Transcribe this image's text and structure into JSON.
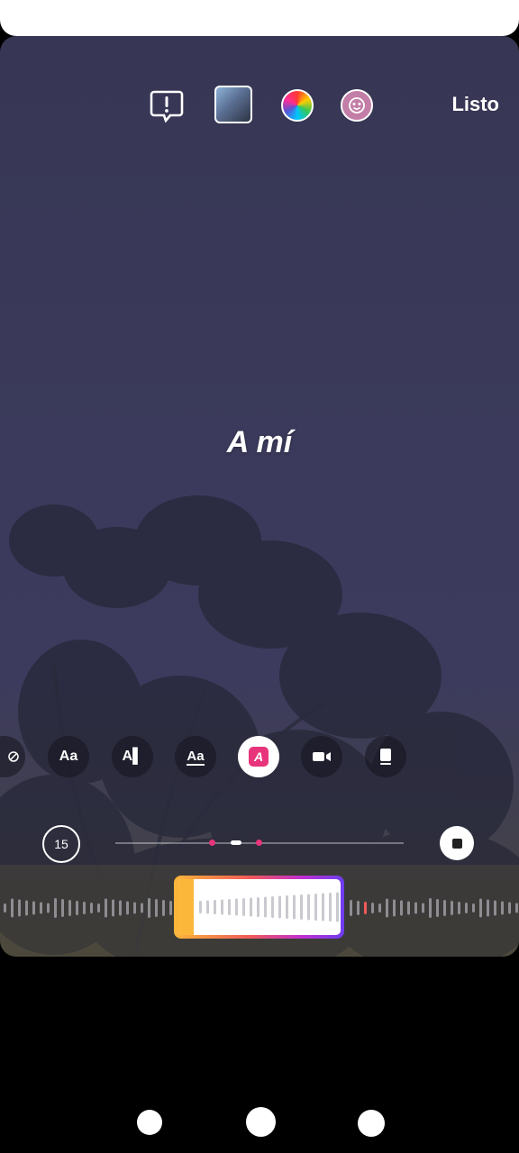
{
  "header": {
    "done_label": "Listo",
    "report_icon": "alert-bubble-icon",
    "effect_icon": "face-filter-icon"
  },
  "caption": {
    "text": "A mí"
  },
  "text_styles": [
    {
      "label": "",
      "icon": "no-style-icon"
    },
    {
      "label": "Aa",
      "icon": "text-style-aa-icon"
    },
    {
      "label": "A▌",
      "icon": "text-style-karaoke-icon"
    },
    {
      "label": "Aa",
      "icon": "text-style-underline-icon"
    },
    {
      "label": "A",
      "icon": "text-style-selected-icon"
    },
    {
      "label": "",
      "icon": "video-style-icon"
    },
    {
      "label": "",
      "icon": "card-style-icon"
    }
  ],
  "timeline": {
    "duration_label": "15"
  },
  "colors": {
    "accent_pink": "#e8347a",
    "gradient_start": "#fbb73a",
    "gradient_end": "#6d3df0"
  }
}
